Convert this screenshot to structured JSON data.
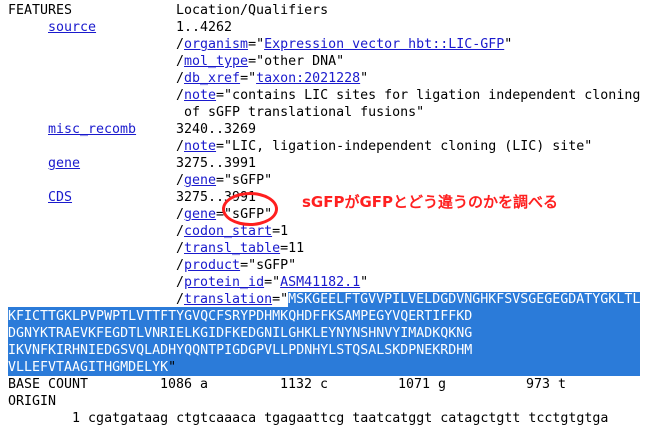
{
  "header": {
    "features": "FEATURES",
    "location": "Location/Qualifiers"
  },
  "source": {
    "key": "source",
    "range": "1..4262",
    "organism": {
      "prefix": "/",
      "name": "organism",
      "eq": "=\"",
      "value": "Expression vector hbt::LIC-GFP",
      "suffix": "\""
    },
    "mol_type": {
      "prefix": "/",
      "name": "mol_type",
      "rest": "=\"other DNA\""
    },
    "db_xref": {
      "prefix": "/",
      "name": "db_xref",
      "eq": "=\"",
      "value": "taxon:2021228",
      "suffix": "\""
    },
    "note": {
      "prefix": "/",
      "name": "note",
      "rest": "=\"contains LIC sites for ligation independent cloning",
      "cont": "of sGFP translational fusions\""
    }
  },
  "misc_recomb": {
    "key": "misc_recomb",
    "range": "3240..3269",
    "note": {
      "prefix": "/",
      "name": "note",
      "rest": "=\"LIC, ligation-independent cloning (LIC) site\""
    }
  },
  "gene_feature": {
    "key": "gene",
    "range": "3275..3991",
    "gene": {
      "prefix": "/",
      "name": "gene",
      "rest": "=\"sGFP\""
    }
  },
  "cds": {
    "key": "CDS",
    "range": "3275..3991",
    "gene": {
      "prefix": "/",
      "name": "gene",
      "rest": "=\"sGFP\""
    },
    "codon_start": {
      "prefix": "/",
      "name": "codon_start",
      "rest": "=1"
    },
    "transl_table": {
      "prefix": "/",
      "name": "transl_table",
      "rest": "=11"
    },
    "product": {
      "prefix": "/",
      "name": "product",
      "rest": "=\"sGFP\""
    },
    "protein_id": {
      "prefix": "/",
      "name": "protein_id",
      "eq": "=\"",
      "value": "ASM41182.1",
      "suffix": "\""
    },
    "translation": {
      "prefix": "/",
      "name": "translation",
      "eq": "=\"",
      "lines": [
        "MSKGEELFTGVVPILVELDGDVNGHKFSVSGEGEGDATYGKLTL",
        "KFICTTGKLPVPWPTLVTTFTYGVQCFSRYPDHMKQHDFFKSAMPEGYVQERTIFFKD",
        "DGNYKTRAEVKFEGDTLVNRIELKGIDFKEDGNILGHKLEYNYNSHNVYIMADKQKNG",
        "IKVNFKIRHNIEDGSVQLADHYQQNTPIGDGPVLLPDNHYLSTQSALSKDPNEKRDHM",
        "VLLEFVTAAGITHGMDELYK"
      ],
      "suffix": "\""
    }
  },
  "annotation": {
    "text": "sGFPがGFPとどう違うのかを調べる",
    "color": "#ff2020"
  },
  "base_count": {
    "label": "BASE COUNT",
    "a": "1086 a",
    "c": "1132 c",
    "g": "1071 g",
    "t": "973 t"
  },
  "origin": {
    "label": "ORIGIN",
    "line1": "        1 cgatgataag ctgtcaaaca tgagaattcg taatcatggt catagctgtt tcctgtgtga"
  },
  "colors": {
    "link": "#1a1acd",
    "highlight": "#2b7bd9",
    "annotation": "#ff2020"
  }
}
